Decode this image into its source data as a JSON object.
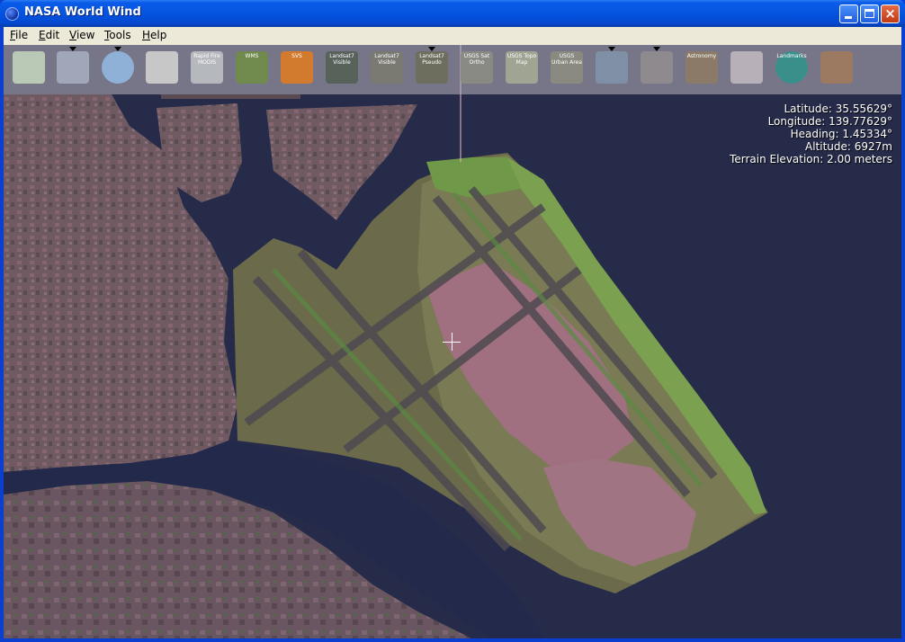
{
  "window": {
    "title": "NASA World Wind"
  },
  "menu": [
    {
      "label": "File",
      "mnemonic": "F",
      "rest": "ile"
    },
    {
      "label": "Edit",
      "mnemonic": "E",
      "rest": "dit"
    },
    {
      "label": "View",
      "mnemonic": "V",
      "rest": "iew"
    },
    {
      "label": "Tools",
      "mnemonic": "T",
      "rest": "ools"
    },
    {
      "label": "Help",
      "mnemonic": "H",
      "rest": "elp"
    }
  ],
  "toolbar": {
    "tools": [
      {
        "name": "layers-icon",
        "caption": ""
      },
      {
        "name": "placenames-grid-icon",
        "caption": ""
      },
      {
        "name": "globe-grid-icon",
        "caption": ""
      },
      {
        "name": "search-magnifier-icon",
        "caption": ""
      },
      {
        "name": "rapid-fire-modis-icon",
        "caption": "Rapid Fire MODIS"
      },
      {
        "name": "wms-icon",
        "caption": "WMS"
      },
      {
        "name": "svs-icon",
        "caption": "SVS"
      },
      {
        "name": "landsat7-visible-nlt-icon",
        "caption": "Landsat7 Visible"
      },
      {
        "name": "landsat7-visible-wms-icon",
        "caption": "Landsat7 Visible"
      },
      {
        "name": "landsat7-pseudo-icon",
        "caption": "Landsat7 Pseudo"
      },
      {
        "name": "usgs-satellite-icon",
        "caption": "USGS Sat Ortho"
      },
      {
        "name": "usgs-topo-map-icon",
        "caption": "USGS Topo Map"
      },
      {
        "name": "usgs-urban-area-icon",
        "caption": "USGS Urban Area"
      },
      {
        "name": "map-overlay-icon",
        "caption": ""
      },
      {
        "name": "compass-network-icon",
        "caption": ""
      },
      {
        "name": "astronomy-icon",
        "caption": "Astronomy"
      },
      {
        "name": "country-flags-icon",
        "caption": ""
      },
      {
        "name": "landmarks-icon",
        "caption": "Landmarks"
      },
      {
        "name": "us-map-icon",
        "caption": ""
      }
    ]
  },
  "info": {
    "latitude": "Latitude: 35.55629°",
    "longitude": "Longitude: 139.77629°",
    "heading": "Heading: 1.45334°",
    "altitude": "Altitude: 6927m",
    "terrain": "Terrain Elevation: 2.00 meters"
  },
  "colors": {
    "water": "#262b4a",
    "land": "#6e5560",
    "green": "#5f8f45"
  }
}
